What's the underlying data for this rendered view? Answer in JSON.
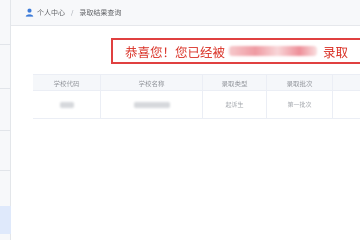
{
  "breadcrumb": {
    "home": "个人中心",
    "separator": "/",
    "current": "录取结果查询",
    "icon": "user-icon"
  },
  "banner": {
    "prefix": "恭喜您！您已经被",
    "suffix": "录取"
  },
  "table": {
    "headers": [
      "学校代码",
      "学校名称",
      "录取类型",
      "录取批次",
      ""
    ],
    "rows": [
      {
        "type": "起诉生",
        "batch": "第一批次"
      }
    ]
  },
  "colors": {
    "accent": "#3d7bd9",
    "banner_red": "#d93025"
  }
}
